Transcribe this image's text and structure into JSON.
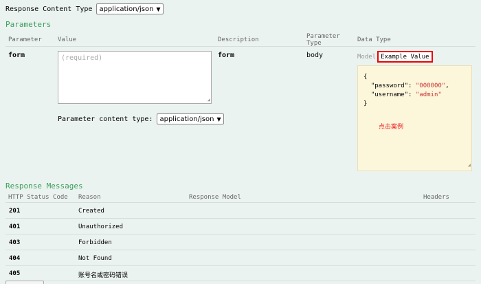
{
  "response_content_type": {
    "label": "Response Content Type",
    "value": "application/json"
  },
  "parameters": {
    "heading": "Parameters",
    "columns": [
      "Parameter",
      "Value",
      "Description",
      "Parameter Type",
      "Data Type"
    ],
    "rows": [
      {
        "name": "form",
        "placeholder": "(required)",
        "description": "form",
        "param_type": "body",
        "content_type_label": "Parameter content type:",
        "content_type_value": "application/json",
        "data_type": {
          "model_tab": "Model",
          "example_tab": "Example Value",
          "example_json": {
            "open": "{",
            "lines": [
              {
                "key": "\"password\"",
                "value": "\"000000\"",
                "trail": ","
              },
              {
                "key": "\"username\"",
                "value": "\"admin\"",
                "trail": ""
              }
            ],
            "close": "}"
          },
          "annotation": "点击案例"
        }
      }
    ]
  },
  "response_messages": {
    "heading": "Response Messages",
    "columns": [
      "HTTP Status Code",
      "Reason",
      "Response Model",
      "Headers"
    ],
    "rows": [
      {
        "code": "201",
        "reason": "Created"
      },
      {
        "code": "401",
        "reason": "Unauthorized"
      },
      {
        "code": "403",
        "reason": "Forbidden"
      },
      {
        "code": "404",
        "reason": "Not Found"
      },
      {
        "code": "405",
        "reason": "账号名或密码错误"
      }
    ]
  },
  "colors": {
    "background": "#ebf3f0",
    "heading": "#3b9c5b",
    "highlight_border": "#e00000",
    "example_bg": "#fcf6db",
    "json_value": "#cc3333",
    "annotation": "#ee2222"
  }
}
